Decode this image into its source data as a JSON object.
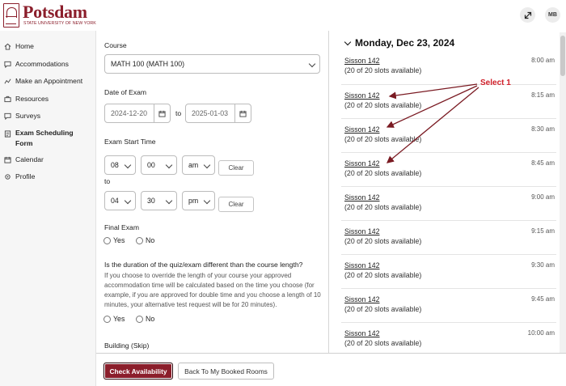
{
  "header": {
    "logo_name": "Potsdam",
    "logo_sub": "STATE UNIVERSITY OF NEW YORK",
    "user_initials": "MB"
  },
  "sidebar": {
    "items": [
      {
        "label": "Home",
        "icon": "home-icon"
      },
      {
        "label": "Accommodations",
        "icon": "chat-icon"
      },
      {
        "label": "Make an Appointment",
        "icon": "chart-icon"
      },
      {
        "label": "Resources",
        "icon": "briefcase-icon"
      },
      {
        "label": "Surveys",
        "icon": "chat-icon"
      },
      {
        "label": "Exam Scheduling Form",
        "icon": "document-icon"
      },
      {
        "label": "Calendar",
        "icon": "calendar-icon"
      },
      {
        "label": "Profile",
        "icon": "gear-icon"
      }
    ]
  },
  "form": {
    "course_label": "Course",
    "course_value": "MATH 100 (MATH 100)",
    "date_label": "Date of Exam",
    "date_from": "2024-12-20",
    "date_to_word": "to",
    "date_to": "2025-01-03",
    "start_label": "Exam Start Time",
    "start_hour": "08",
    "start_min": "00",
    "start_ampm": "am",
    "clear_label": "Clear",
    "to_word": "to",
    "end_hour": "04",
    "end_min": "30",
    "end_ampm": "pm",
    "final_label": "Final Exam",
    "yes": "Yes",
    "no": "No",
    "duration_question": "Is the duration of the quiz/exam different than the course length?",
    "duration_help": "If you choose to override the length of your course your approved accommodation time will be calculated based on the time you choose (for example, if you are approved for double time and you choose a length of 10 minutes, your alternative test request will be for 20 minutes).",
    "building_label": "Building (Skip)"
  },
  "slots": {
    "date_heading": "Monday, Dec 23, 2024",
    "items": [
      {
        "room": "Sisson 142",
        "avail": "(20 of 20 slots available)",
        "time": "8:00 am"
      },
      {
        "room": "Sisson 142",
        "avail": "(20 of 20 slots available)",
        "time": "8:15 am"
      },
      {
        "room": "Sisson 142",
        "avail": "(20 of 20 slots available)",
        "time": "8:30 am"
      },
      {
        "room": "Sisson 142",
        "avail": "(20 of 20 slots available)",
        "time": "8:45 am"
      },
      {
        "room": "Sisson 142",
        "avail": "(20 of 20 slots available)",
        "time": "9:00 am"
      },
      {
        "room": "Sisson 142",
        "avail": "(20 of 20 slots available)",
        "time": "9:15 am"
      },
      {
        "room": "Sisson 142",
        "avail": "(20 of 20 slots available)",
        "time": "9:30 am"
      },
      {
        "room": "Sisson 142",
        "avail": "(20 of 20 slots available)",
        "time": "9:45 am"
      },
      {
        "room": "Sisson 142",
        "avail": "(20 of 20 slots available)",
        "time": "10:00 am"
      }
    ],
    "annotation": "Select 1"
  },
  "footer": {
    "check_label": "Check Availability",
    "back_label": "Back To My Booked Rooms"
  },
  "colors": {
    "brand": "#8b1e2b",
    "annotation": "#d0202a"
  }
}
